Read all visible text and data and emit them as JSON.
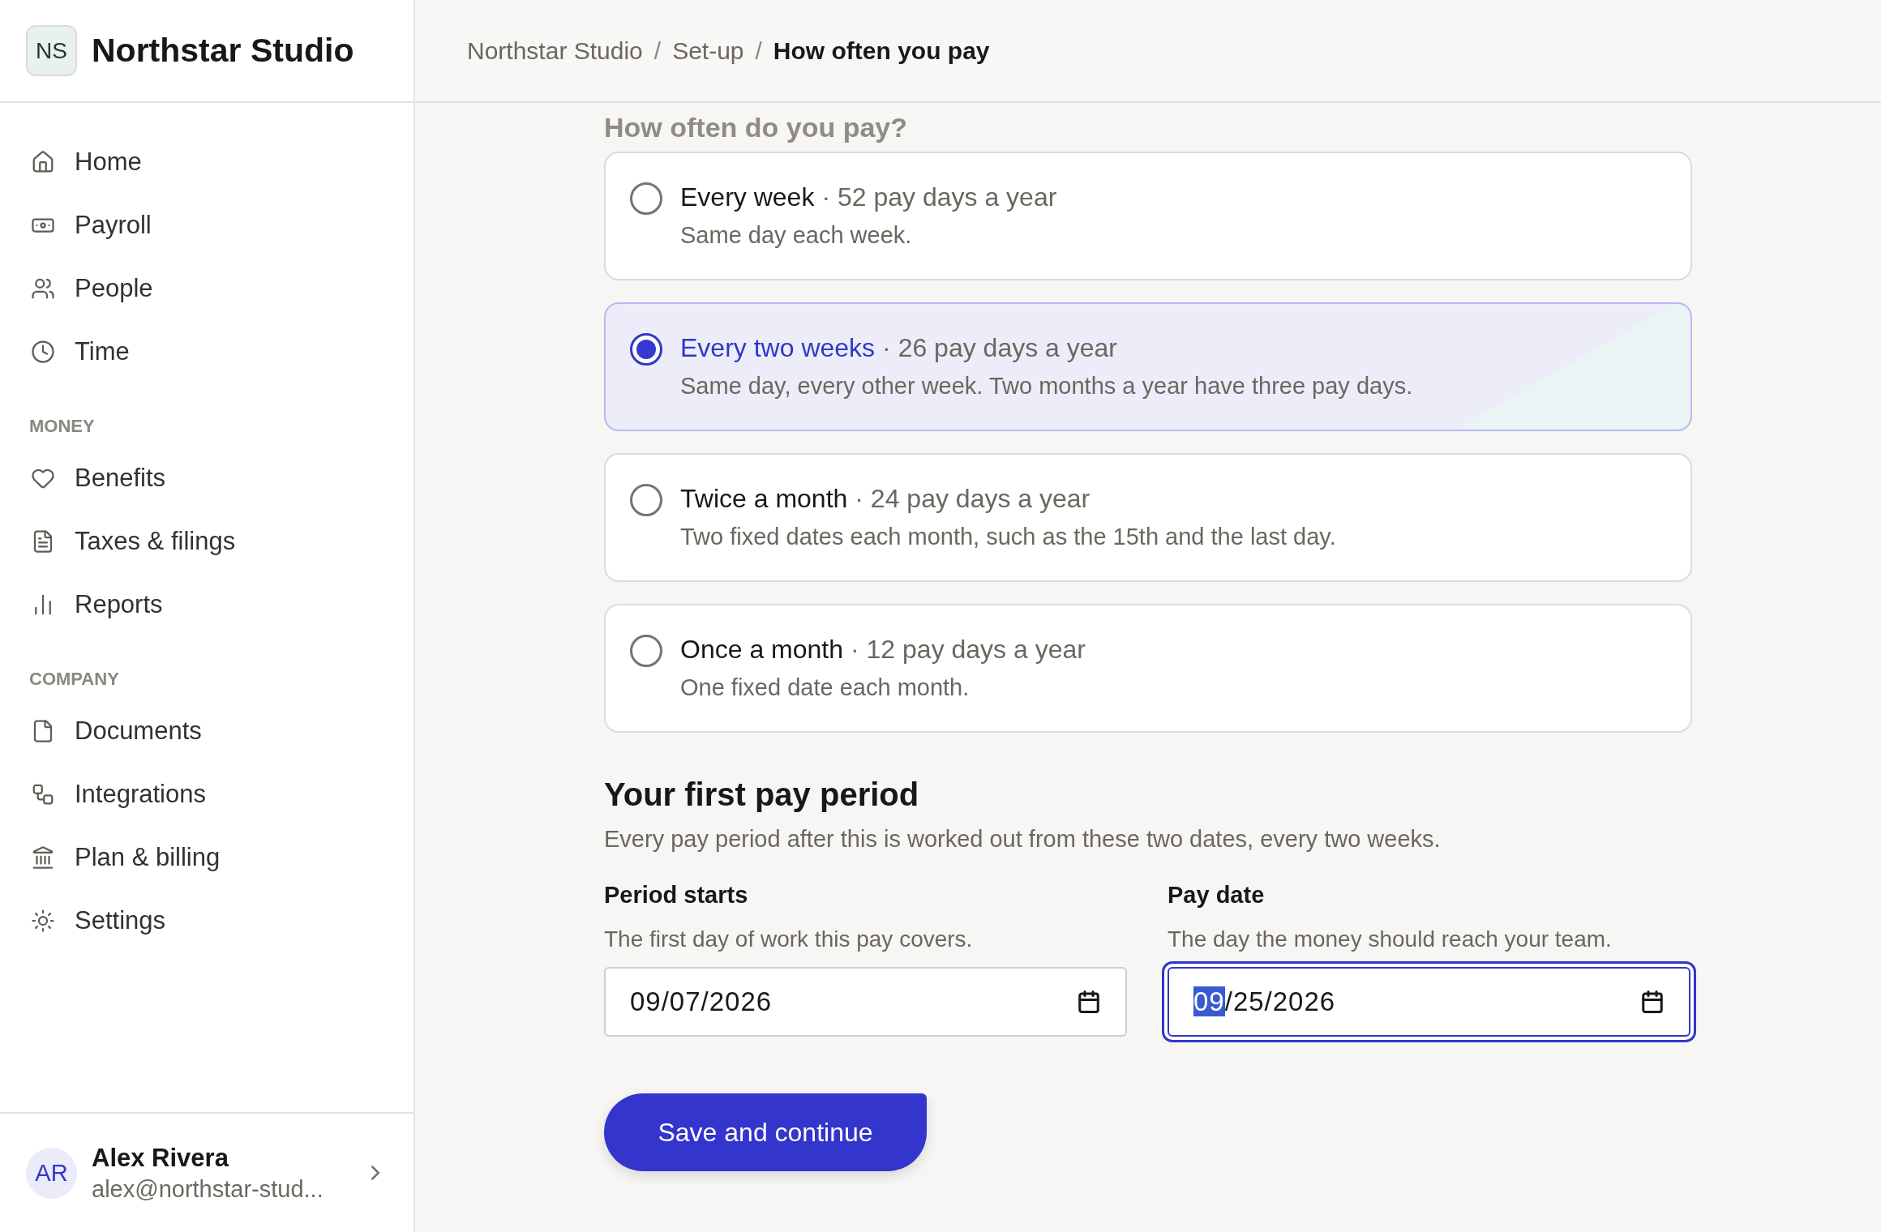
{
  "brand": {
    "initials": "NS",
    "name": "Northstar Studio"
  },
  "nav_sections": [
    {
      "items": [
        {
          "label": "Home"
        },
        {
          "label": "Payroll"
        },
        {
          "label": "People"
        },
        {
          "label": "Time"
        }
      ]
    },
    {
      "heading": "MONEY",
      "items": [
        {
          "label": "Benefits"
        },
        {
          "label": "Taxes & filings"
        },
        {
          "label": "Reports"
        }
      ]
    },
    {
      "heading": "COMPANY",
      "items": [
        {
          "label": "Documents"
        },
        {
          "label": "Integrations"
        },
        {
          "label": "Plan & billing"
        },
        {
          "label": "Settings"
        }
      ]
    }
  ],
  "user": {
    "initials": "AR",
    "name": "Alex Rivera",
    "email": "alex@northstar-stud..."
  },
  "breadcrumb": [
    {
      "label": "Northstar Studio",
      "current": false
    },
    {
      "label": "Set-up",
      "current": false
    },
    {
      "label": "How often you pay",
      "current": true
    }
  ],
  "breadcrumb_separator": "/",
  "page_heading": "How often do you pay?",
  "options": [
    {
      "title": "Every week",
      "detail": "· 52 pay days a year",
      "description": "Same day each week.",
      "selected": false
    },
    {
      "title": "Every two weeks",
      "detail": "· 26 pay days a year",
      "description": "Same day, every other week. Two months a year have three pay days.",
      "selected": true
    },
    {
      "title": "Twice a month",
      "detail": "· 24 pay days a year",
      "description": "Two fixed dates each month, such as the 15th and the last day.",
      "selected": false
    },
    {
      "title": "Once a month",
      "detail": "· 12 pay days a year",
      "description": "One fixed date each month.",
      "selected": false
    }
  ],
  "section": {
    "title": "Your first pay period",
    "description": "Every pay period after this is worked out from these two dates, every two weeks."
  },
  "fields": [
    {
      "label": "Period starts",
      "help": "The first day of work this pay covers.",
      "value": "09/07/2026",
      "focused": false
    },
    {
      "label": "Pay date",
      "help": "The day the money should reach your team.",
      "value": "09/25/2026",
      "focused": true
    }
  ],
  "button": "Save and continue"
}
